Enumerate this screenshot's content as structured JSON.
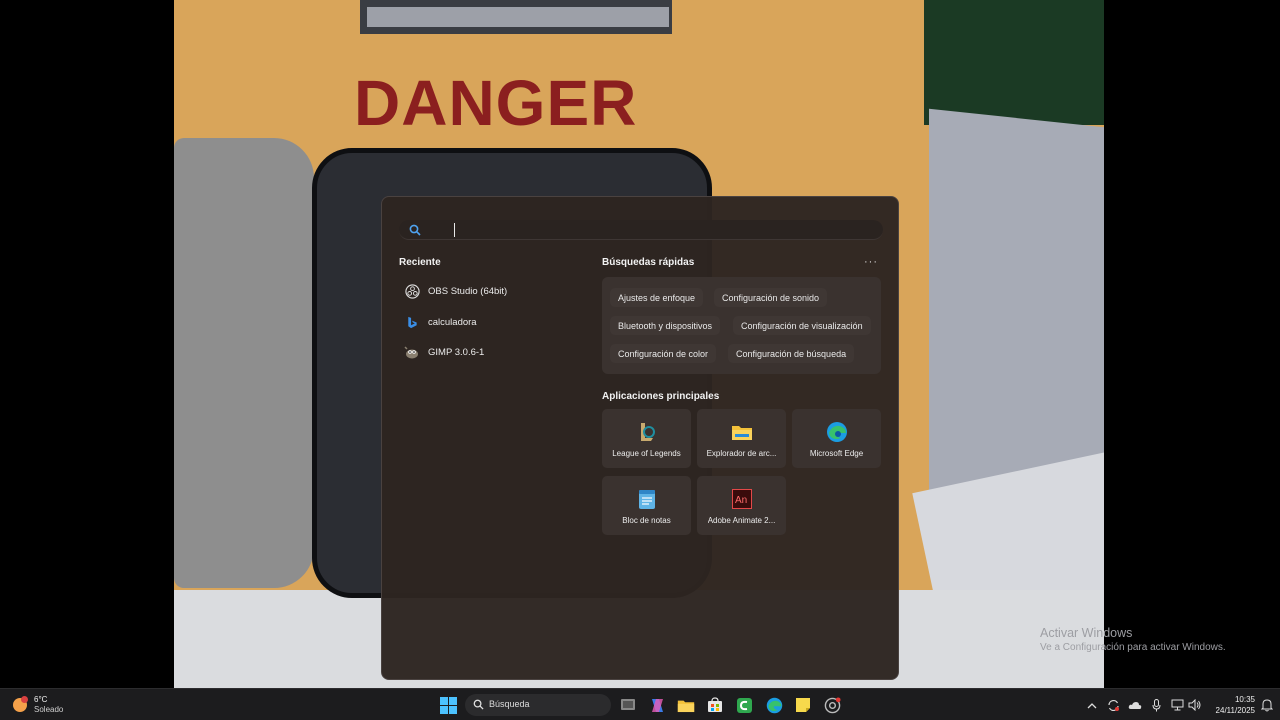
{
  "wallpaper": {
    "sign_text": "DANGER"
  },
  "watermark": {
    "line1": "Activar Windows",
    "line2": "Ve a Configuración para activar Windows."
  },
  "start_menu": {
    "search": {
      "value": "",
      "placeholder": ""
    },
    "recent": {
      "title": "Reciente",
      "items": [
        {
          "label": "OBS Studio (64bit)",
          "icon": "obs-icon"
        },
        {
          "label": "calculadora",
          "icon": "bing-icon"
        },
        {
          "label": "GIMP 3.0.6-1",
          "icon": "gimp-icon"
        }
      ]
    },
    "quick": {
      "title": "Búsquedas rápidas",
      "more": "···",
      "chips": [
        "Ajustes de enfoque",
        "Configuración de sonido",
        "Bluetooth y dispositivos",
        "Configuración de visualización",
        "Configuración de color",
        "Configuración de búsqueda"
      ]
    },
    "apps": {
      "title": "Aplicaciones principales",
      "items": [
        {
          "label": "League of Legends",
          "icon": "league-of-legends-icon"
        },
        {
          "label": "Explorador de arc...",
          "icon": "folder-icon"
        },
        {
          "label": "Microsoft Edge",
          "icon": "edge-icon"
        },
        {
          "label": "Bloc de notas",
          "icon": "notepad-icon"
        },
        {
          "label": "Adobe Animate 2...",
          "icon": "adobe-animate-icon"
        }
      ]
    }
  },
  "taskbar": {
    "weather": {
      "temp": "6°C",
      "condition": "Soleado"
    },
    "search_label": "Búsqueda",
    "clock": {
      "time": "10:35",
      "date": "24/11/2025"
    }
  },
  "colors": {
    "menu_bg": "#2d2521",
    "taskbar_bg": "#1c1c1e",
    "accent": "#1e90ff",
    "danger_red": "#8b1f1f"
  }
}
